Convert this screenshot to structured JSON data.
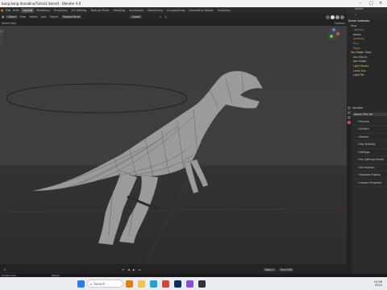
{
  "window": {
    "title": "bang bang donadino/Tuhno1.blend] - Blender 4.0"
  },
  "menu": [
    "File",
    "Edit",
    "Render",
    "Window",
    "Help"
  ],
  "workspaces": [
    "Layout",
    "Modeling",
    "Sculpting",
    "UV Editing",
    "Texture Paint",
    "Shading",
    "Animation",
    "Rendering",
    "Compositing",
    "Geometry Nodes",
    "Scripting"
  ],
  "header": {
    "mode": "Object",
    "global": "Global",
    "add": "Add",
    "object": "Object",
    "retopo": "RetopoTecat",
    "view": "View",
    "select": "Select"
  },
  "header2": {
    "options": "Options",
    "gizmo": "Select Box"
  },
  "outliner": {
    "header": "Scene",
    "items": [
      {
        "label": "Scene Collection",
        "color": "#ffffff"
      },
      {
        "label": "ritus",
        "color": "#cfcfcf"
      },
      {
        "label": "Lighting",
        "color": "#8a8a8a"
      },
      {
        "label": "bones",
        "color": "#cfcfcf"
      },
      {
        "label": "pentyng",
        "color": "#e08a3a"
      },
      {
        "label": "Tuto",
        "color": "#8a8a8a"
      },
      {
        "label": "Plane",
        "color": "#e08a3a"
      },
      {
        "label": "Irex Maker Tools",
        "color": "#cfcfcf"
      },
      {
        "label": "Irex (Rach)",
        "color": "#e8c15a"
      },
      {
        "label": "Irex Maker",
        "color": "#cfcfcf"
      },
      {
        "label": "Light Studio",
        "color": "#e8c15a"
      },
      {
        "label": "Lamp Sun",
        "color": "#e8c15a"
      },
      {
        "label": "Light Tar",
        "color": "#cfcfcf"
      }
    ]
  },
  "properties": {
    "object": "irocable",
    "search_label": "Aaron The Ge",
    "sections": [
      "Preview",
      "Surface",
      "Volume",
      "Ray Visibility",
      "Settings",
      "Pos Lighting Studio",
      "Sex Position",
      "Viewport Display",
      "Custom Propertie"
    ]
  },
  "timeline": {
    "start_label": "Start",
    "start": "1",
    "end_label": "End",
    "end": "250",
    "frame": "0"
  },
  "statusbar": {
    "left": "Rotate View",
    "right": "Object"
  },
  "taskbar": {
    "search_placeholder": "Search",
    "time": "10:38",
    "date": "2024"
  },
  "colors": {
    "accent": "#4772b3",
    "active_ws": "#4a4a4a",
    "orange": "#e08a3a"
  },
  "icons": [
    "windows-icon",
    "search-icon",
    "blender-icon",
    "folder-icon",
    "edge-icon",
    "chrome-icon",
    "photoshop-icon"
  ]
}
